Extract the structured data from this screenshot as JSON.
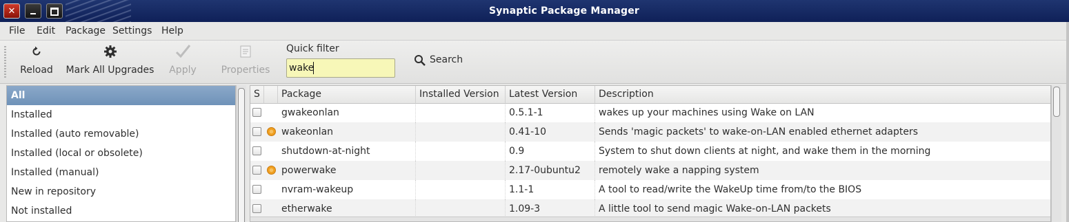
{
  "window": {
    "title": "Synaptic Package Manager",
    "close_glyph": "✕"
  },
  "menubar": {
    "items": [
      {
        "label": "File"
      },
      {
        "label": "Edit"
      },
      {
        "label": "Package"
      },
      {
        "label": "Settings"
      },
      {
        "label": "Help"
      }
    ]
  },
  "toolbar": {
    "reload_label": "Reload",
    "mark_all_upgrades_label": "Mark All Upgrades",
    "apply_label": "Apply",
    "properties_label": "Properties",
    "quick_filter_label": "Quick filter",
    "quick_filter_value": "wake",
    "search_label": "Search"
  },
  "filters": {
    "items": [
      {
        "label": "All",
        "selected": true
      },
      {
        "label": "Installed"
      },
      {
        "label": "Installed (auto removable)"
      },
      {
        "label": "Installed (local or obsolete)"
      },
      {
        "label": "Installed (manual)"
      },
      {
        "label": "New in repository"
      },
      {
        "label": "Not installed"
      }
    ]
  },
  "table": {
    "columns": [
      "S",
      "",
      "Package",
      "Installed Version",
      "Latest Version",
      "Description"
    ],
    "rows": [
      {
        "package": "gwakeonlan",
        "installed_version": "",
        "latest_version": "0.5.1-1",
        "description": "wakes up your machines using Wake on LAN",
        "supported": false
      },
      {
        "package": "wakeonlan",
        "installed_version": "",
        "latest_version": "0.41-10",
        "description": "Sends 'magic packets' to wake-on-LAN enabled ethernet adapters",
        "supported": true
      },
      {
        "package": "shutdown-at-night",
        "installed_version": "",
        "latest_version": "0.9",
        "description": "System to shut down clients at night, and wake them in the morning",
        "supported": false
      },
      {
        "package": "powerwake",
        "installed_version": "",
        "latest_version": "2.17-0ubuntu2",
        "description": "remotely wake a napping system",
        "supported": true
      },
      {
        "package": "nvram-wakeup",
        "installed_version": "",
        "latest_version": "1.1-1",
        "description": "A tool to read/write the WakeUp time from/to the BIOS",
        "supported": false
      },
      {
        "package": "etherwake",
        "installed_version": "",
        "latest_version": "1.09-3",
        "description": "A little tool to send magic Wake-on-LAN packets",
        "supported": false
      }
    ]
  },
  "colors": {
    "titlebar": "#1f3570",
    "selection": "#7897bd",
    "quick_filter_bg": "#f7f7b8",
    "support_icon": "#f0a020"
  }
}
